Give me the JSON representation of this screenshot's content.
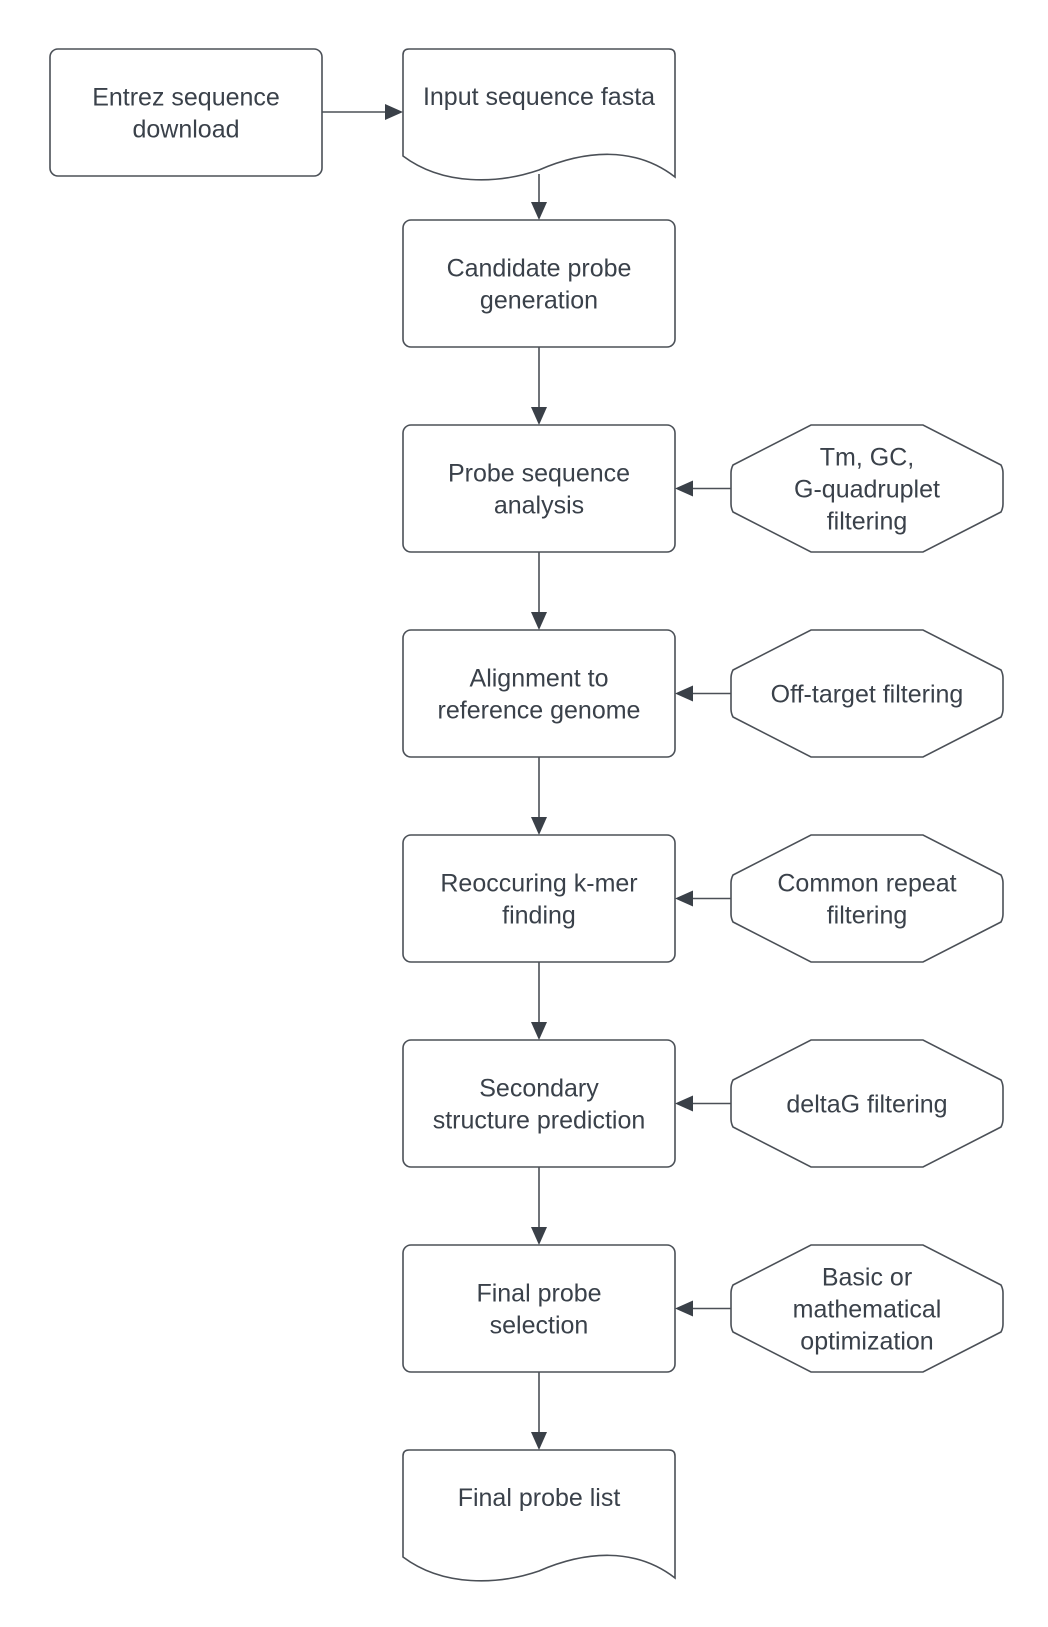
{
  "diagram": {
    "type": "flowchart",
    "nodes": [
      {
        "id": "entrez",
        "kind": "process",
        "lines": [
          "Entrez sequence",
          "download"
        ]
      },
      {
        "id": "input",
        "kind": "document",
        "lines": [
          "Input sequence fasta"
        ]
      },
      {
        "id": "candidate",
        "kind": "process",
        "lines": [
          "Candidate probe",
          "generation"
        ]
      },
      {
        "id": "analysis",
        "kind": "process",
        "lines": [
          "Probe sequence",
          "analysis"
        ]
      },
      {
        "id": "alignment",
        "kind": "process",
        "lines": [
          "Alignment to",
          "reference genome"
        ]
      },
      {
        "id": "kmer",
        "kind": "process",
        "lines": [
          "Reoccuring k-mer",
          "finding"
        ]
      },
      {
        "id": "secondary",
        "kind": "process",
        "lines": [
          "Secondary",
          "structure prediction"
        ]
      },
      {
        "id": "selection",
        "kind": "process",
        "lines": [
          "Final probe",
          "selection"
        ]
      },
      {
        "id": "final_list",
        "kind": "document",
        "lines": [
          "Final probe list"
        ]
      },
      {
        "id": "tm_gc",
        "kind": "octagon",
        "lines": [
          "Tm, GC,",
          "G-quadruplet",
          "filtering"
        ]
      },
      {
        "id": "offtarget",
        "kind": "octagon",
        "lines": [
          "Off-target filtering"
        ]
      },
      {
        "id": "repeat",
        "kind": "octagon",
        "lines": [
          "Common repeat",
          "filtering"
        ]
      },
      {
        "id": "deltag",
        "kind": "octagon",
        "lines": [
          "deltaG filtering"
        ]
      },
      {
        "id": "optimization",
        "kind": "octagon",
        "lines": [
          "Basic or",
          "mathematical",
          "optimization"
        ]
      }
    ],
    "edges": [
      {
        "from": "entrez",
        "to": "input"
      },
      {
        "from": "input",
        "to": "candidate"
      },
      {
        "from": "candidate",
        "to": "analysis"
      },
      {
        "from": "analysis",
        "to": "alignment"
      },
      {
        "from": "alignment",
        "to": "kmer"
      },
      {
        "from": "kmer",
        "to": "secondary"
      },
      {
        "from": "secondary",
        "to": "selection"
      },
      {
        "from": "selection",
        "to": "final_list"
      },
      {
        "from": "tm_gc",
        "to": "analysis"
      },
      {
        "from": "offtarget",
        "to": "alignment"
      },
      {
        "from": "repeat",
        "to": "kmer"
      },
      {
        "from": "deltag",
        "to": "secondary"
      },
      {
        "from": "optimization",
        "to": "selection"
      }
    ]
  }
}
